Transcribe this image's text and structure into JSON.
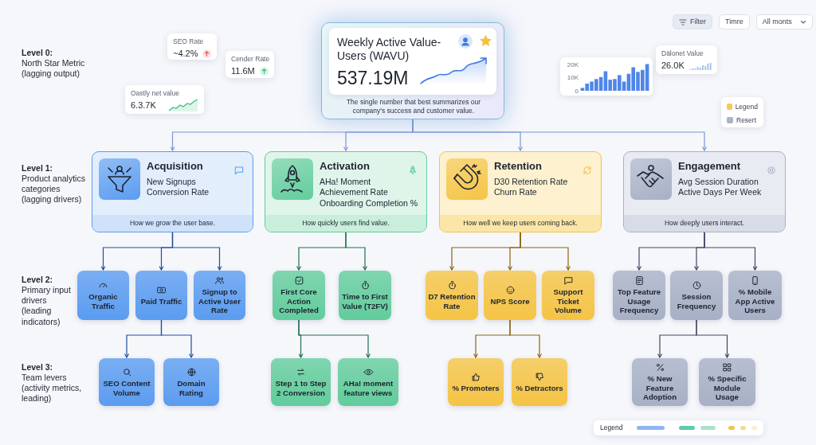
{
  "toolbar": [
    {
      "label": "Filter",
      "kind": "filter",
      "selected": true
    },
    {
      "label": "Timre",
      "kind": "plain",
      "selected": false
    },
    {
      "label": "All monts",
      "kind": "dropdown",
      "selected": false
    }
  ],
  "level_labels": [
    {
      "title": "Level 0:",
      "lines": [
        "North Star Metric",
        "(lagging output)"
      ]
    },
    {
      "title": "Level 1:",
      "lines": [
        "Product analytics",
        "categories",
        "(lagging drivers)"
      ]
    },
    {
      "title": "Level 2:",
      "lines": [
        "Primary input",
        "drivers",
        "(leading",
        "indicators)"
      ]
    },
    {
      "title": "Level 3:",
      "lines": [
        "Team levers",
        "(activity metrics,",
        "leading)"
      ]
    }
  ],
  "kpi_cards": [
    {
      "label": "SEO Rate",
      "value": "~4.2%",
      "kind": "trend",
      "color": "#e0605a"
    },
    {
      "label": "Cender Rate",
      "value": "11.6M",
      "kind": "trend",
      "color": "#3dbb86"
    },
    {
      "label": "Oastly net value",
      "value": "6.3.7K",
      "kind": "sparkline"
    },
    {
      "label": "Dälonet Value",
      "value": "26.0K",
      "kind": "minibars"
    }
  ],
  "north_star": {
    "title": "Weekly Active Value-Users (WAVU)",
    "value": "537.19M",
    "description": "The single number that best summarizes our company's success and customer value."
  },
  "bar_chart": {
    "chart_data": {
      "type": "bar",
      "ylim": [
        0,
        22000
      ],
      "yticks": [
        {
          "value": 0,
          "label": "0"
        },
        {
          "value": 10000,
          "label": "10K"
        },
        {
          "value": 20000,
          "label": "20K"
        }
      ],
      "categories": [
        null,
        null,
        null,
        null,
        null,
        null,
        null,
        null,
        null,
        null,
        null,
        null,
        null,
        null,
        null
      ],
      "series": [
        {
          "color": "#4f86e8",
          "values": [
            2200,
            5500,
            7000,
            9000,
            10500,
            15000,
            8500,
            9000,
            12000,
            7000,
            13000,
            18000,
            14500,
            16000,
            20500
          ]
        }
      ]
    }
  },
  "side_legend": [
    {
      "label": "Legend",
      "color": "#f6c85a"
    },
    {
      "label": "Resert",
      "color": "#aab3c7"
    }
  ],
  "categories": [
    {
      "name": "Acquisition",
      "color": "#5b9cf0",
      "metrics": [
        "New Signups",
        "Conversion Rate"
      ],
      "description": "How we grow the user base.",
      "drivers": [
        {
          "label": "Organic Traffic"
        },
        {
          "label": "Paid Traffic",
          "children": [
            {
              "label": "SEO Content Volume"
            },
            {
              "label": "Domain Rating"
            }
          ]
        },
        {
          "label": "Signup to Active User Rate"
        }
      ]
    },
    {
      "name": "Activation",
      "color": "#62cc9c",
      "metrics": [
        "AHa! Moment Achievement Rate",
        "Onboarding Completion %"
      ],
      "description": "How quickly users find value.",
      "drivers": [
        {
          "label": "First Core Action Completed",
          "children": [
            {
              "label": "Step 1 to Step 2 Conversion"
            },
            {
              "label": "AHa! moment feature views"
            }
          ]
        },
        {
          "label": "Time to First Value (T2FV)"
        }
      ]
    },
    {
      "name": "Retention",
      "color": "#f5c445",
      "metrics": [
        "D30 Retention Rate",
        "Churn Rate"
      ],
      "description": "How well we keep users coming back.",
      "drivers": [
        {
          "label": "D7 Retention Rate"
        },
        {
          "label": "NPS Score",
          "children": [
            {
              "label": "% Promoters"
            },
            {
              "label": "% Detractors"
            }
          ]
        },
        {
          "label": "Support Ticket Volume"
        }
      ]
    },
    {
      "name": "Engagement",
      "color": "#a7b0c6",
      "metrics": [
        "Avg Session Duration",
        "Active Days Per Week"
      ],
      "description": "How deeply users interact.",
      "drivers": [
        {
          "label": "Top Feature Usage Frequency"
        },
        {
          "label": "Session Frequency",
          "children": [
            {
              "label": "% New Feature Adoption"
            },
            {
              "label": "% Specific Module Usage"
            }
          ]
        },
        {
          "label": "% Mobile App Active Users"
        }
      ]
    }
  ],
  "legend": {
    "label": "Legend",
    "swatches": [
      {
        "color": "#8db6f2"
      },
      {
        "color": "#5ecaae"
      },
      {
        "color": "#a9e2ca"
      },
      {
        "color": "#f5c24c"
      },
      {
        "color": "#f7d98c"
      },
      {
        "color": "#fbeccb"
      }
    ]
  }
}
